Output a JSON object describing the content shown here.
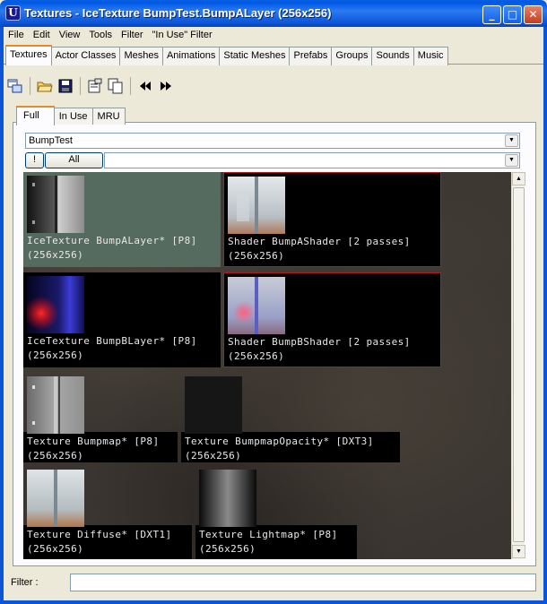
{
  "window": {
    "title": "Textures - IceTexture BumpTest.BumpALayer (256x256)",
    "icon_letter": "U",
    "minimize_glyph": "_",
    "maximize_glyph": "□",
    "close_glyph": "✕"
  },
  "menu": [
    "File",
    "Edit",
    "View",
    "Tools",
    "Filter",
    "\"In Use\" Filter"
  ],
  "category_tabs": [
    "Textures",
    "Actor Classes",
    "Meshes",
    "Animations",
    "Static Meshes",
    "Prefabs",
    "Groups",
    "Sounds",
    "Music"
  ],
  "active_category_tab": "Textures",
  "toolbar_icons": [
    "browser-icon",
    "open-folder-icon",
    "save-icon",
    "properties-icon",
    "copy-icon",
    "previous-icon",
    "next-icon"
  ],
  "sub_tabs": [
    "Full",
    "In Use",
    "MRU"
  ],
  "active_sub_tab": "Full",
  "package_combo": {
    "value": "BumpTest"
  },
  "group_bar": {
    "exclaim_label": "!",
    "all_label": "All",
    "group_value": ""
  },
  "textures": [
    {
      "name": "IceTexture BumpALayer* [P8]",
      "size": "(256x256)",
      "selected": true,
      "shader": false
    },
    {
      "name": "Shader BumpAShader [2 passes]",
      "size": "(256x256)",
      "selected": false,
      "shader": true
    },
    {
      "name": "IceTexture BumpBLayer* [P8]",
      "size": "(256x256)",
      "selected": false,
      "shader": false
    },
    {
      "name": "Shader BumpBShader [2 passes]",
      "size": "(256x256)",
      "selected": false,
      "shader": true
    },
    {
      "name": "Texture Bumpmap* [P8]",
      "size": "(256x256)",
      "selected": false,
      "shader": false
    },
    {
      "name": "Texture BumpmapOpacity* [DXT3]",
      "size": "(256x256)",
      "selected": false,
      "shader": false
    },
    {
      "name": "Texture Diffuse* [DXT1]",
      "size": "(256x256)",
      "selected": false,
      "shader": false
    },
    {
      "name": "Texture Lightmap* [P8]",
      "size": "(256x256)",
      "selected": false,
      "shader": false
    }
  ],
  "filter": {
    "label": "Filter :",
    "value": ""
  }
}
